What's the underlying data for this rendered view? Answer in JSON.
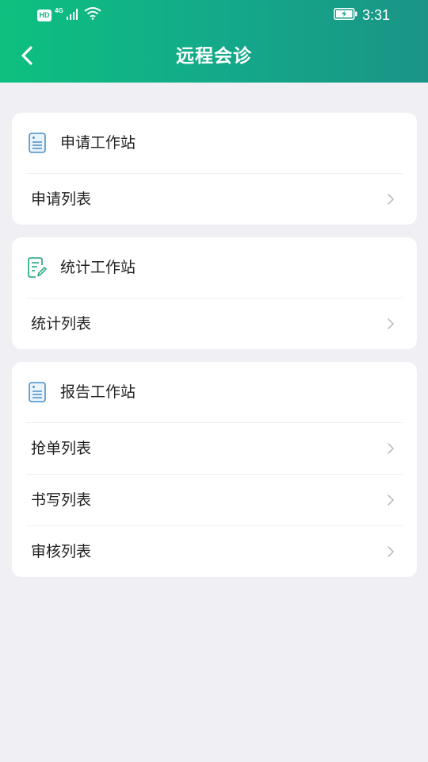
{
  "status_bar": {
    "hd_label": "HD",
    "network_label": "4G",
    "time": "3:31"
  },
  "nav": {
    "title": "远程会诊"
  },
  "sections": [
    {
      "title": "申请工作站",
      "icon": "document-list-icon",
      "items": [
        {
          "label": "申请列表"
        }
      ]
    },
    {
      "title": "统计工作站",
      "icon": "document-edit-icon",
      "items": [
        {
          "label": "统计列表"
        }
      ]
    },
    {
      "title": "报告工作站",
      "icon": "document-list-icon",
      "items": [
        {
          "label": "抢单列表"
        },
        {
          "label": "书写列表"
        },
        {
          "label": "审核列表"
        }
      ]
    }
  ],
  "colors": {
    "header_start": "#0dc07f",
    "header_end": "#1a9486",
    "background": "#efeff4",
    "icon_blue": "#4a90c8",
    "icon_green": "#1aa37a"
  }
}
